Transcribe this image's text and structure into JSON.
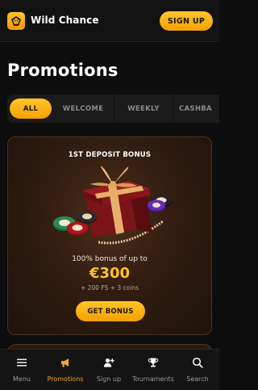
{
  "header": {
    "brand": "Wild Chance",
    "signup_label": "SIGN UP",
    "logo_icon": "lion-icon"
  },
  "page_title": "Promotions",
  "tabs": [
    {
      "label": "ALL",
      "active": true
    },
    {
      "label": "WELCOME",
      "active": false
    },
    {
      "label": "WEEKLY",
      "active": false
    },
    {
      "label": "CASHBA",
      "active": false
    }
  ],
  "promo": {
    "eyebrow": "1ST DEPOSIT BONUS",
    "description": "100% bonus of up to",
    "amount": "€300",
    "extra": "+ 200 FS + 3 coins",
    "cta": "GET BONUS"
  },
  "bottom_nav": [
    {
      "label": "Menu",
      "icon": "menu-icon",
      "active": false
    },
    {
      "label": "Promotions",
      "icon": "megaphone-icon",
      "active": true
    },
    {
      "label": "Sign up",
      "icon": "add-user-icon",
      "active": false
    },
    {
      "label": "Tournaments",
      "icon": "trophy-icon",
      "active": false
    },
    {
      "label": "Search",
      "icon": "search-icon",
      "active": false
    }
  ],
  "colors": {
    "accent": "#ffb300",
    "background": "#0d0d0d",
    "active_nav": "#f5a623"
  }
}
